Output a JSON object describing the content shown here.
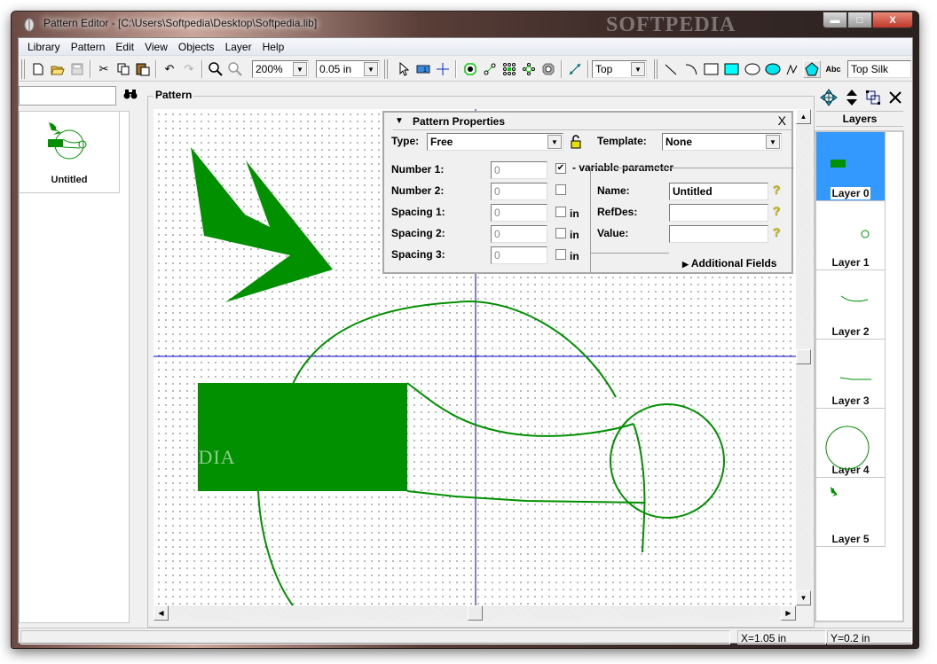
{
  "window": {
    "title": "Pattern Editor - [C:\\Users\\Softpedia\\Desktop\\Softpedia.lib]",
    "watermark": "SOFTPEDIA",
    "minimize_label": "▬",
    "maximize_label": "□",
    "close_label": "X"
  },
  "menu": [
    "Library",
    "Pattern",
    "Edit",
    "View",
    "Objects",
    "Layer",
    "Help"
  ],
  "toolbar": {
    "zoom_value": "200%",
    "grid_value": "0.05 in",
    "side_value": "Top",
    "layer_value": "Top Silk",
    "text_tool_label": "Abc"
  },
  "left_panel": {
    "search_value": "",
    "patterns": [
      {
        "name": "Untitled"
      }
    ]
  },
  "pattern_group": {
    "legend": "Pattern"
  },
  "properties": {
    "title": "Pattern Properties",
    "type_label": "Type:",
    "type_value": "Free",
    "template_label": "Template:",
    "template_value": "None",
    "number1_label": "Number 1:",
    "number1_value": "0",
    "number1_checked": true,
    "variable_label": "- variable parameter",
    "number2_label": "Number 2:",
    "number2_value": "0",
    "spacing1_label": "Spacing 1:",
    "spacing1_value": "0",
    "spacing2_label": "Spacing 2:",
    "spacing2_value": "0",
    "spacing3_label": "Spacing 3:",
    "spacing3_value": "0",
    "unit": "in",
    "name_label": "Name:",
    "name_value": "Untitled",
    "refdes_label": "RefDes:",
    "refdes_value": "",
    "value_label": "Value:",
    "value_value": "",
    "additional_label": "Additional Fields",
    "close_label": "X"
  },
  "layers": {
    "header": "Layers",
    "items": [
      {
        "name": "Layer 0",
        "selected": true
      },
      {
        "name": "Layer 1",
        "selected": false
      },
      {
        "name": "Layer 2",
        "selected": false
      },
      {
        "name": "Layer 3",
        "selected": false
      },
      {
        "name": "Layer 4",
        "selected": false
      },
      {
        "name": "Layer 5",
        "selected": false
      }
    ]
  },
  "status": {
    "message": "",
    "x": "X=1.05 in",
    "y": "Y=0.2 in"
  },
  "colors": {
    "shape": "#009000",
    "guide": "#0000cc",
    "layer_selected": "#3399ff"
  }
}
